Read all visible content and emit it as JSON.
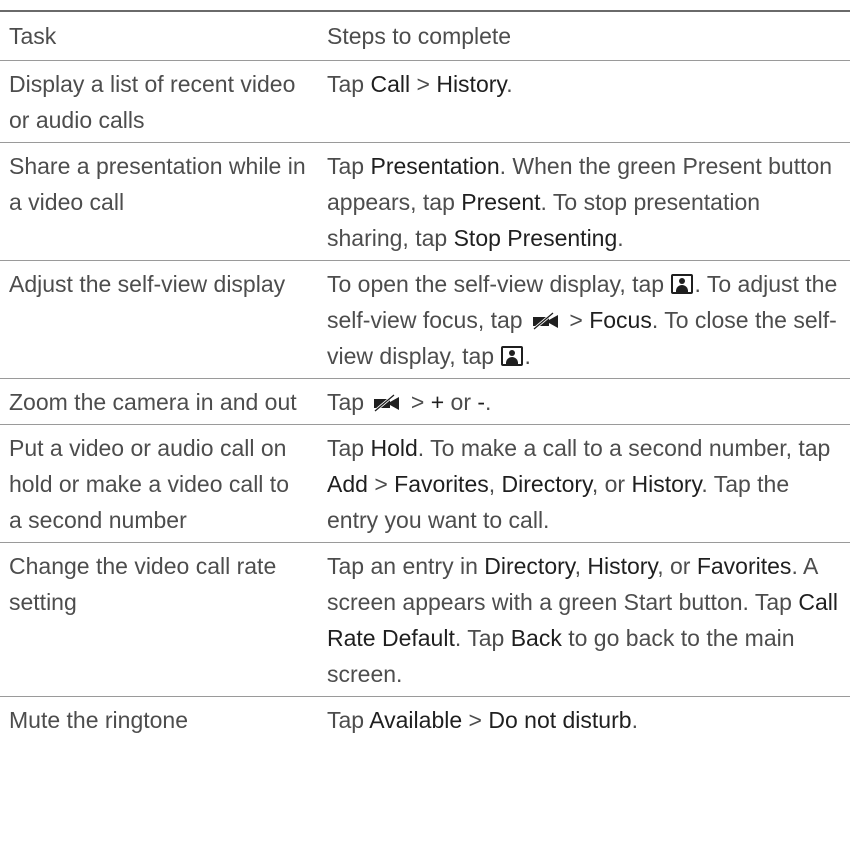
{
  "headers": {
    "task": "Task",
    "steps": "Steps to complete"
  },
  "row1": {
    "task": "Display a list of recent video or audio calls",
    "p1": "Tap ",
    "call": "Call",
    "gt": " > ",
    "history": "History",
    "end": "."
  },
  "row2": {
    "task": "Share a presentation while in a video call",
    "p1": "Tap ",
    "presentation": "Presentation",
    "p2": ". When the green Present button appears, tap ",
    "present": "Present",
    "p3": ". To stop presentation sharing, tap ",
    "stop": "Stop Presenting",
    "end": "."
  },
  "row3": {
    "task": "Adjust the self-view display",
    "p1": "To open the self-view display, tap ",
    "p2": ". To adjust the self-view focus, tap ",
    "gt": " > ",
    "focus": "Focus",
    "p3": ". To close the self-view display, tap ",
    "end": "."
  },
  "row4": {
    "task": "Zoom the camera in and out",
    "p1": "Tap ",
    "gt": " > ",
    "plus": "+",
    "or": " or ",
    "minus": "-",
    "end": "."
  },
  "row5": {
    "task": "Put a video or audio call on hold or make a video call to a second number",
    "p1": "Tap ",
    "hold": "Hold",
    "p2": ". To make a call to a second number, tap ",
    "add": "Add",
    "gt": " > ",
    "favorites": "Favorites",
    "comma": ", ",
    "directory": "Directory",
    "or": ", or ",
    "history": "History",
    "p3": ". Tap the entry you want to call."
  },
  "row6": {
    "task": "Change the video call rate setting",
    "p1": "Tap an entry in ",
    "directory": "Directory",
    "comma": ", ",
    "history": "History",
    "or": ", or ",
    "favorites": "Favorites",
    "p2": ". A screen appears with a green Start button. Tap ",
    "rate": "Call Rate Default",
    "p3": ". Tap ",
    "back": "Back",
    "p4": " to go back to the main screen."
  },
  "row7": {
    "task": "Mute the ringtone",
    "p1": "Tap ",
    "available": "Available",
    "gt": " > ",
    "dnd": "Do not disturb",
    "end": "."
  },
  "icons": {
    "self_view": "self-view-icon",
    "camera_off": "camera-off-icon"
  },
  "colors": {
    "body_text": "#4d4d4d",
    "ui_term": "#1f1f1f",
    "rule": "#9a9a9a"
  }
}
